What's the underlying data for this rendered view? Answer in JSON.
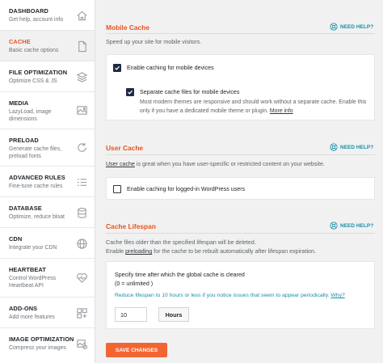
{
  "sidebar": {
    "items": [
      {
        "title": "DASHBOARD",
        "desc": "Get help, account info",
        "icon": "home-icon"
      },
      {
        "title": "CACHE",
        "desc": "Basic cache options",
        "icon": "file-icon"
      },
      {
        "title": "FILE OPTIMIZATION",
        "desc": "Optimize CSS & JS",
        "icon": "layers-icon"
      },
      {
        "title": "MEDIA",
        "desc": "LazyLoad, image dimensions",
        "icon": "image-icon"
      },
      {
        "title": "PRELOAD",
        "desc": "Generate cache files, preload fonts",
        "icon": "refresh-icon"
      },
      {
        "title": "ADVANCED RULES",
        "desc": "Fine-tune cache rules",
        "icon": "list-icon"
      },
      {
        "title": "DATABASE",
        "desc": "Optimize, reduce bloat",
        "icon": "database-icon"
      },
      {
        "title": "CDN",
        "desc": "Integrate your CDN",
        "icon": "globe-icon"
      },
      {
        "title": "HEARTBEAT",
        "desc": "Control WordPress Heartbeat API",
        "icon": "heartbeat-icon"
      },
      {
        "title": "ADD-ONS",
        "desc": "Add more features",
        "icon": "addons-icon"
      },
      {
        "title": "IMAGE OPTIMIZATION",
        "desc": "Compress your images",
        "icon": "image-optimization-icon"
      }
    ]
  },
  "help_label": "NEED HELP?",
  "mobile": {
    "title": "Mobile Cache",
    "intro": "Speed up your site for mobile visitors.",
    "enable_label": "Enable caching for mobile devices",
    "separate_label": "Separate cache files for mobile devices",
    "separate_desc_1": "Most modern themes are responsive and should work without a separate cache. Enable this",
    "separate_desc_2": "only if you have a dedicated mobile theme or plugin.",
    "more_info": "More info"
  },
  "user": {
    "title": "User Cache",
    "intro_link": "User cache",
    "intro_rest": " is great when you have user-specific or restricted content on your website.",
    "enable_label": "Enable caching for logged-in WordPress users"
  },
  "lifespan": {
    "title": "Cache Lifespan",
    "intro_1": "Cache files older than the specified lifespan will be deleted.",
    "intro_2_pre": "Enable ",
    "intro_2_link": "preloading",
    "intro_2_post": " for the cache to be rebuilt automatically after lifespan expiration.",
    "label_1": "Specify time after which the global cache is cleared",
    "label_2": "(0 = unlimited )",
    "hint": "Reduce lifespan to 10 hours or less if you notice issues that seem to appear periodically.",
    "hint_link": "Why?",
    "value": "10",
    "unit": "Hours"
  },
  "save_label": "SAVE CHANGES",
  "colors": {
    "accent": "#e8531f",
    "button": "#f26533",
    "help": "#1a8fa8",
    "checkbox": "#1f2a44"
  }
}
